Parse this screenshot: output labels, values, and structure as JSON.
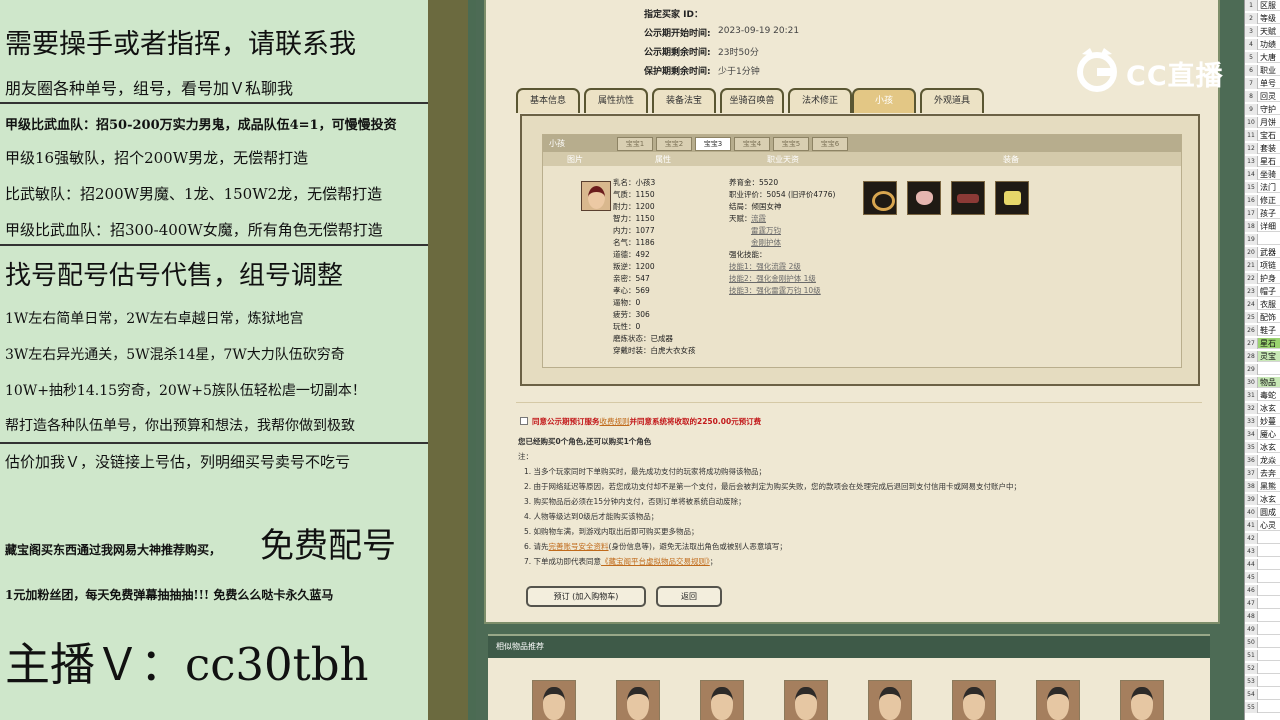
{
  "left_panel": {
    "lines": [
      "需要操手或者指挥，请联系我",
      "朋友圈各种单号，组号，看号加Ｖ私聊我",
      "甲级比武血队：招50-200万实力男鬼，成品队伍4=1，可慢慢投资",
      "甲级16强敏队，招个200W男龙，无偿帮打造",
      "比武敏队：招200W男魔、1龙、150W2龙，无偿帮打造",
      "甲级比武血队：招300-400W女魔，所有角色无偿帮打造",
      "找号配号估号代售，组号调整",
      "1W左右简单日常，2W左右卓越日常，炼狱地宫",
      "3W左右异光通关，5W混杀14星，7W大力队伍砍穷奇",
      "10W+抽秒14.15穷奇，20W+5族队伍轻松虐一切副本！",
      "帮打造各种队伍单号，你出预算和想法，我帮你做到极致",
      "估价加我Ｖ，没链接上号估，列明细买号卖号不吃亏",
      "藏宝阁买东西通过我网易大神推荐购买，",
      "免费配号",
      "1元加粉丝团，每天免费弹幕抽抽抽!!! 免费么么哒卡永久蓝马",
      "主播Ｖ：cc30tbh"
    ]
  },
  "info": {
    "buyer_label": "指定买家 ID：",
    "start_label": "公示期开始时间:",
    "start_value": "2023-09-19 20:21",
    "remain_label": "公示期剩余时间:",
    "remain_value": "23时50分",
    "protect_label": "保护期剩余时间:",
    "protect_value": "少于1分钟"
  },
  "tabs": [
    "基本信息",
    "属性抗性",
    "装备法宝",
    "坐骑召唤兽",
    "法术修正",
    "小孩",
    "外观道具"
  ],
  "active_tab": "小孩",
  "child": {
    "header": "小孩",
    "subtabs": [
      "宝宝1",
      "宝宝2",
      "宝宝3",
      "宝宝4",
      "宝宝5",
      "宝宝6"
    ],
    "active_subtab": "宝宝3",
    "columns": [
      "图片",
      "属性",
      "职业天资",
      "装备"
    ],
    "attrs": [
      "乳名：小孩3",
      "气质：1150",
      "耐力：1200",
      "智力：1150",
      "内力：1077",
      "名气：1186",
      "道德：492",
      "叛逆：1200",
      "亲密：547",
      "孝心：569",
      "逼物：0",
      "疲劳：306",
      "玩性：0",
      "磨炼状态：已成器",
      "穿戴时装：白虎大衣女孩"
    ],
    "career": {
      "support_money": "养育金：5520",
      "career_eval": "职业评价：5054 (旧评价4776)",
      "ending": "结局：倾国女神",
      "talent_label": "天赋：",
      "talents": [
        "流霞",
        "雷霆万钧",
        "金刚护体"
      ],
      "enhance_label": "强化技能：",
      "enhances": [
        "技能1：强化流霞 2级",
        "技能2：强化金刚护体 1级",
        "技能3：强化雷霆万钧 10级"
      ]
    },
    "equipment": [
      "gold-ring-icon",
      "pink-pouch-icon",
      "red-scroll-icon",
      "gold-ingot-icon"
    ]
  },
  "order": {
    "agree_text": "同意公示期预订服务",
    "rule_link": "收费规则",
    "agree_fee": "并同意系统将收取的2250.00元预订费",
    "bought_text": "您已经购买0个角色,还可以购买1个角色",
    "note_label": "注：",
    "notes": [
      "1. 当多个玩家同时下单购买时，最先成功支付的玩家将成功购得该物品；",
      "2. 由于网络延迟等原因，若您成功支付却不是第一个支付，最后会被判定为购买失败，您的款项会在处理完成后退回到支付信用卡或网易支付账户中；",
      "3. 购买物品后必须在15分钟内支付，否则订单将被系统自动废除；",
      "4. 人物等级达到0级后才能购买该物品；",
      "5. 如购物车满，到游戏内取出后即可购买更多物品；"
    ],
    "note6_a": "6. 请先",
    "note6_link": "完善账号安全资料",
    "note6_b": "(身份信息等)，避免无法取出角色或被别人恶意填写；",
    "note7_a": "7. 下单成功即代表同意",
    "note7_link": "《藏宝阁平台虚拟物品交易规则》",
    "note7_b": "；",
    "preorder_button": "预订 (加入购物车)",
    "back_button": "返回"
  },
  "recommend": {
    "title": "相似物品推荐"
  },
  "excel": {
    "rows": [
      [
        "1",
        "区服"
      ],
      [
        "2",
        "等级"
      ],
      [
        "3",
        "天赋"
      ],
      [
        "4",
        "功绩"
      ],
      [
        "5",
        "大唐"
      ],
      [
        "6",
        "职业"
      ],
      [
        "7",
        "单号"
      ],
      [
        "8",
        "回灵"
      ],
      [
        "9",
        "守护"
      ],
      [
        "10",
        "月饼"
      ],
      [
        "11",
        "宝石"
      ],
      [
        "12",
        "套装"
      ],
      [
        "13",
        "星石"
      ],
      [
        "14",
        "坐骑"
      ],
      [
        "15",
        "法门"
      ],
      [
        "16",
        "修正"
      ],
      [
        "17",
        "孩子"
      ],
      [
        "18",
        "详细"
      ],
      [
        "19",
        ""
      ],
      [
        "20",
        "武器"
      ],
      [
        "21",
        "项链"
      ],
      [
        "22",
        "护身"
      ],
      [
        "23",
        "帽子"
      ],
      [
        "24",
        "衣服"
      ],
      [
        "25",
        "配饰"
      ],
      [
        "26",
        "鞋子"
      ],
      [
        "27",
        "星石"
      ],
      [
        "28",
        "灵宝"
      ],
      [
        "29",
        ""
      ],
      [
        "30",
        "物品"
      ],
      [
        "31",
        "毒蛇"
      ],
      [
        "32",
        "冰玄"
      ],
      [
        "33",
        "妙蔓"
      ],
      [
        "34",
        "魇心"
      ],
      [
        "35",
        "冰玄"
      ],
      [
        "36",
        "龙焱"
      ],
      [
        "37",
        "去奔"
      ],
      [
        "38",
        "黑熊"
      ],
      [
        "39",
        "冰玄"
      ],
      [
        "40",
        "圆成"
      ],
      [
        "41",
        "心灵"
      ],
      [
        "42",
        ""
      ],
      [
        "43",
        ""
      ],
      [
        "44",
        ""
      ],
      [
        "45",
        ""
      ],
      [
        "46",
        ""
      ],
      [
        "47",
        ""
      ],
      [
        "48",
        ""
      ],
      [
        "49",
        ""
      ],
      [
        "50",
        ""
      ],
      [
        "51",
        ""
      ],
      [
        "52",
        ""
      ],
      [
        "53",
        ""
      ],
      [
        "54",
        ""
      ],
      [
        "55",
        ""
      ]
    ]
  },
  "watermark": {
    "text": "CC直播"
  }
}
